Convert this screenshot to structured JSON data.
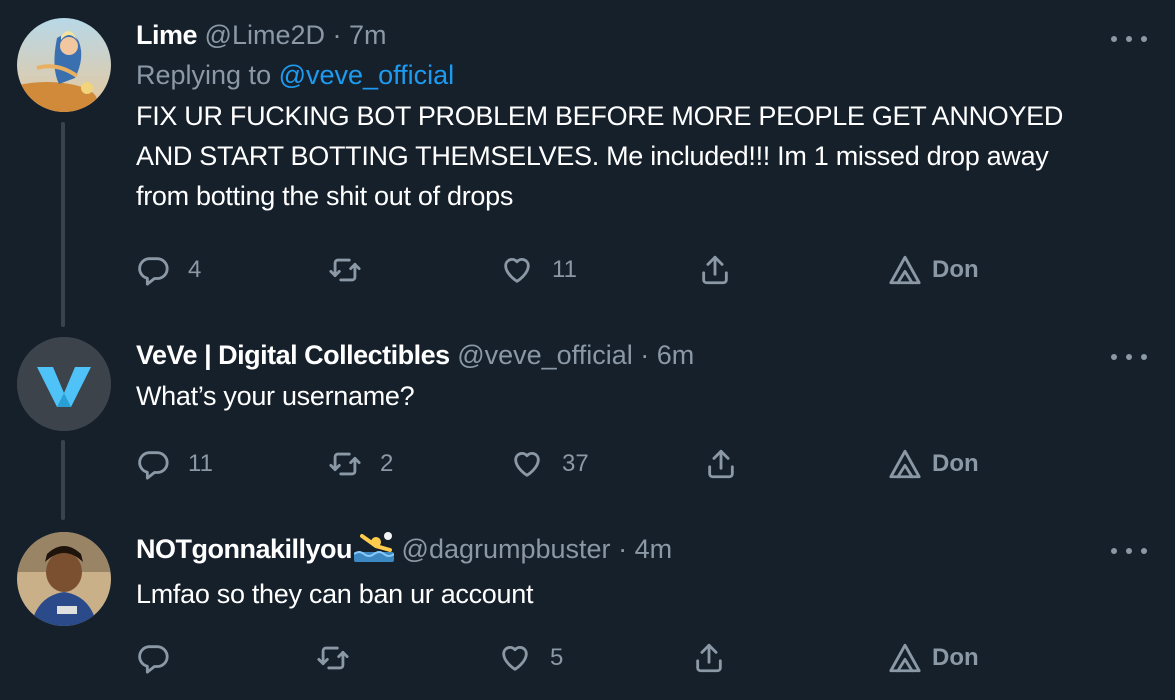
{
  "tweets": [
    {
      "name": "Lime",
      "handle": "@Lime2D",
      "sep": "·",
      "time": "7m",
      "replying_prefix": "Replying to",
      "replying_to": "@veve_official",
      "lines": [
        "FIX UR FUCKING BOT PROBLEM BEFORE MORE PEOPLE GET ANNOYED",
        "AND START BOTTING THEMSELVES. Me included!!! Im 1 missed drop away",
        "from botting the shit out of drops"
      ],
      "replies": "4",
      "retweets": "",
      "likes": "11",
      "promote_label": "Don"
    },
    {
      "name": "VeVe | Digital Collectibles",
      "handle": "@veve_official",
      "sep": "·",
      "time": "6m",
      "lines": [
        "What’s your username?"
      ],
      "replies": "11",
      "retweets": "2",
      "likes": "37",
      "promote_label": "Don"
    },
    {
      "name": "NOTgonnakillyou",
      "handle": "@dagrumpbuster",
      "sep": "·",
      "time": "4m",
      "lines": [
        "Lmfao so they can ban ur account"
      ],
      "replies": "",
      "retweets": "",
      "likes": "5",
      "promote_label": "Don"
    }
  ],
  "colors": {
    "background": "#15202b",
    "secondary_text": "#8b98a5",
    "link": "#1d9bf0",
    "veve_accent": "#4fc3f7"
  },
  "icons": [
    "reply-icon",
    "retweet-icon",
    "like-icon",
    "share-icon",
    "analytics-icon",
    "more-icon",
    "water-polo-emoji-icon"
  ]
}
